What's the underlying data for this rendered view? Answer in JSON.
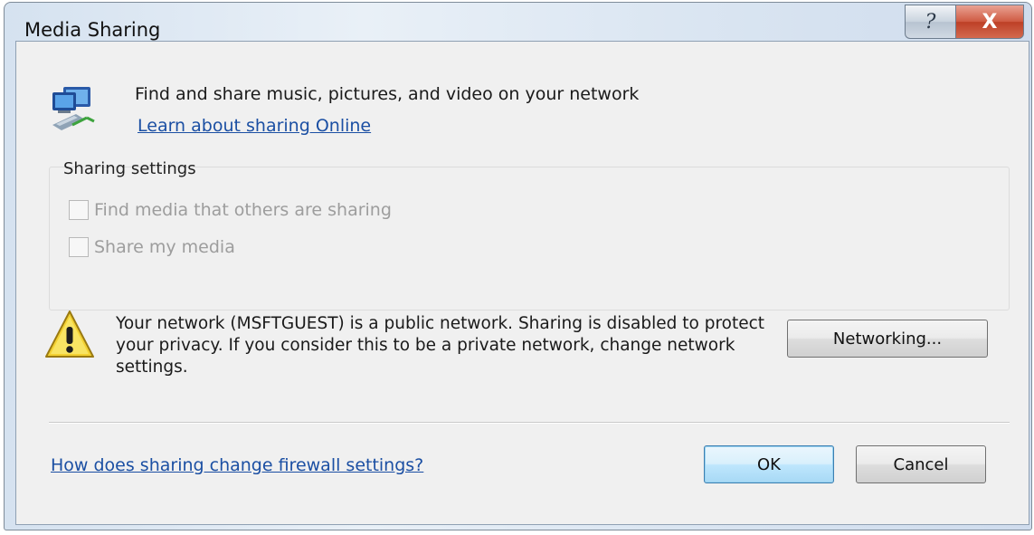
{
  "window": {
    "title": "Media Sharing",
    "help_glyph": "?",
    "close_glyph": "X"
  },
  "intro": {
    "icon": "network-media-icon",
    "text": "Find and share music, pictures, and video on your network",
    "link": "Learn about sharing Online"
  },
  "sharing_settings": {
    "label": "Sharing settings",
    "options": [
      {
        "label": "Find media that others are sharing",
        "checked": false,
        "enabled": false
      },
      {
        "label": "Share my media",
        "checked": false,
        "enabled": false
      }
    ]
  },
  "warning": {
    "icon": "warning-icon",
    "text": "Your network (MSFTGUEST) is a public network. Sharing is disabled to protect your privacy. If you consider this to be a private network, change network settings.",
    "button": "Networking..."
  },
  "footer": {
    "link": "How does sharing change firewall settings?",
    "ok": "OK",
    "cancel": "Cancel"
  },
  "colors": {
    "link": "#1b4fa3",
    "disabled_text": "#9d9d9d",
    "close_button": "#c9482f",
    "default_button_border": "#3c7fb1"
  }
}
